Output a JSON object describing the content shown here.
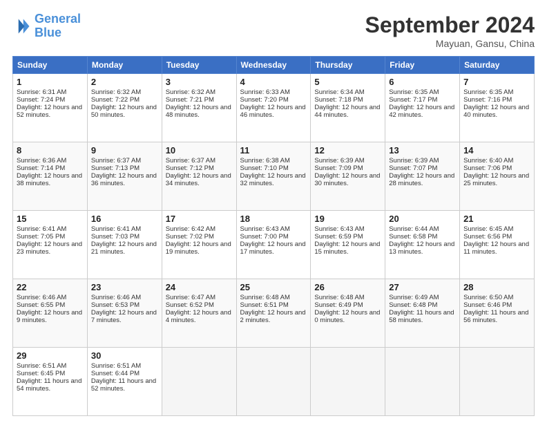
{
  "header": {
    "logo_line1": "General",
    "logo_line2": "Blue",
    "month": "September 2024",
    "location": "Mayuan, Gansu, China"
  },
  "weekdays": [
    "Sunday",
    "Monday",
    "Tuesday",
    "Wednesday",
    "Thursday",
    "Friday",
    "Saturday"
  ],
  "weeks": [
    [
      {
        "day": "1",
        "sunrise": "Sunrise: 6:31 AM",
        "sunset": "Sunset: 7:24 PM",
        "daylight": "Daylight: 12 hours and 52 minutes."
      },
      {
        "day": "2",
        "sunrise": "Sunrise: 6:32 AM",
        "sunset": "Sunset: 7:22 PM",
        "daylight": "Daylight: 12 hours and 50 minutes."
      },
      {
        "day": "3",
        "sunrise": "Sunrise: 6:32 AM",
        "sunset": "Sunset: 7:21 PM",
        "daylight": "Daylight: 12 hours and 48 minutes."
      },
      {
        "day": "4",
        "sunrise": "Sunrise: 6:33 AM",
        "sunset": "Sunset: 7:20 PM",
        "daylight": "Daylight: 12 hours and 46 minutes."
      },
      {
        "day": "5",
        "sunrise": "Sunrise: 6:34 AM",
        "sunset": "Sunset: 7:18 PM",
        "daylight": "Daylight: 12 hours and 44 minutes."
      },
      {
        "day": "6",
        "sunrise": "Sunrise: 6:35 AM",
        "sunset": "Sunset: 7:17 PM",
        "daylight": "Daylight: 12 hours and 42 minutes."
      },
      {
        "day": "7",
        "sunrise": "Sunrise: 6:35 AM",
        "sunset": "Sunset: 7:16 PM",
        "daylight": "Daylight: 12 hours and 40 minutes."
      }
    ],
    [
      {
        "day": "8",
        "sunrise": "Sunrise: 6:36 AM",
        "sunset": "Sunset: 7:14 PM",
        "daylight": "Daylight: 12 hours and 38 minutes."
      },
      {
        "day": "9",
        "sunrise": "Sunrise: 6:37 AM",
        "sunset": "Sunset: 7:13 PM",
        "daylight": "Daylight: 12 hours and 36 minutes."
      },
      {
        "day": "10",
        "sunrise": "Sunrise: 6:37 AM",
        "sunset": "Sunset: 7:12 PM",
        "daylight": "Daylight: 12 hours and 34 minutes."
      },
      {
        "day": "11",
        "sunrise": "Sunrise: 6:38 AM",
        "sunset": "Sunset: 7:10 PM",
        "daylight": "Daylight: 12 hours and 32 minutes."
      },
      {
        "day": "12",
        "sunrise": "Sunrise: 6:39 AM",
        "sunset": "Sunset: 7:09 PM",
        "daylight": "Daylight: 12 hours and 30 minutes."
      },
      {
        "day": "13",
        "sunrise": "Sunrise: 6:39 AM",
        "sunset": "Sunset: 7:07 PM",
        "daylight": "Daylight: 12 hours and 28 minutes."
      },
      {
        "day": "14",
        "sunrise": "Sunrise: 6:40 AM",
        "sunset": "Sunset: 7:06 PM",
        "daylight": "Daylight: 12 hours and 25 minutes."
      }
    ],
    [
      {
        "day": "15",
        "sunrise": "Sunrise: 6:41 AM",
        "sunset": "Sunset: 7:05 PM",
        "daylight": "Daylight: 12 hours and 23 minutes."
      },
      {
        "day": "16",
        "sunrise": "Sunrise: 6:41 AM",
        "sunset": "Sunset: 7:03 PM",
        "daylight": "Daylight: 12 hours and 21 minutes."
      },
      {
        "day": "17",
        "sunrise": "Sunrise: 6:42 AM",
        "sunset": "Sunset: 7:02 PM",
        "daylight": "Daylight: 12 hours and 19 minutes."
      },
      {
        "day": "18",
        "sunrise": "Sunrise: 6:43 AM",
        "sunset": "Sunset: 7:00 PM",
        "daylight": "Daylight: 12 hours and 17 minutes."
      },
      {
        "day": "19",
        "sunrise": "Sunrise: 6:43 AM",
        "sunset": "Sunset: 6:59 PM",
        "daylight": "Daylight: 12 hours and 15 minutes."
      },
      {
        "day": "20",
        "sunrise": "Sunrise: 6:44 AM",
        "sunset": "Sunset: 6:58 PM",
        "daylight": "Daylight: 12 hours and 13 minutes."
      },
      {
        "day": "21",
        "sunrise": "Sunrise: 6:45 AM",
        "sunset": "Sunset: 6:56 PM",
        "daylight": "Daylight: 12 hours and 11 minutes."
      }
    ],
    [
      {
        "day": "22",
        "sunrise": "Sunrise: 6:46 AM",
        "sunset": "Sunset: 6:55 PM",
        "daylight": "Daylight: 12 hours and 9 minutes."
      },
      {
        "day": "23",
        "sunrise": "Sunrise: 6:46 AM",
        "sunset": "Sunset: 6:53 PM",
        "daylight": "Daylight: 12 hours and 7 minutes."
      },
      {
        "day": "24",
        "sunrise": "Sunrise: 6:47 AM",
        "sunset": "Sunset: 6:52 PM",
        "daylight": "Daylight: 12 hours and 4 minutes."
      },
      {
        "day": "25",
        "sunrise": "Sunrise: 6:48 AM",
        "sunset": "Sunset: 6:51 PM",
        "daylight": "Daylight: 12 hours and 2 minutes."
      },
      {
        "day": "26",
        "sunrise": "Sunrise: 6:48 AM",
        "sunset": "Sunset: 6:49 PM",
        "daylight": "Daylight: 12 hours and 0 minutes."
      },
      {
        "day": "27",
        "sunrise": "Sunrise: 6:49 AM",
        "sunset": "Sunset: 6:48 PM",
        "daylight": "Daylight: 11 hours and 58 minutes."
      },
      {
        "day": "28",
        "sunrise": "Sunrise: 6:50 AM",
        "sunset": "Sunset: 6:46 PM",
        "daylight": "Daylight: 11 hours and 56 minutes."
      }
    ],
    [
      {
        "day": "29",
        "sunrise": "Sunrise: 6:51 AM",
        "sunset": "Sunset: 6:45 PM",
        "daylight": "Daylight: 11 hours and 54 minutes."
      },
      {
        "day": "30",
        "sunrise": "Sunrise: 6:51 AM",
        "sunset": "Sunset: 6:44 PM",
        "daylight": "Daylight: 11 hours and 52 minutes."
      },
      null,
      null,
      null,
      null,
      null
    ]
  ]
}
